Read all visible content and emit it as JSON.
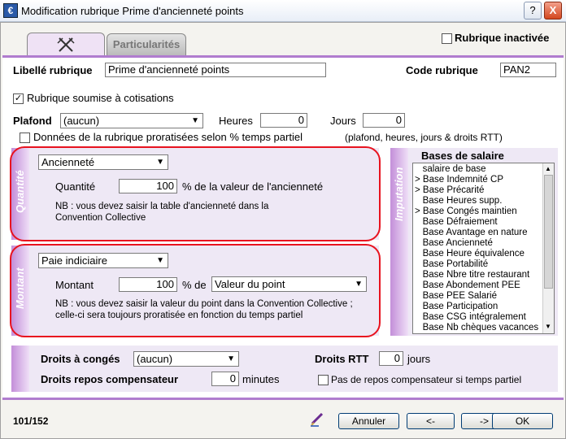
{
  "window": {
    "title": "Modification rubrique Prime d'ancienneté points",
    "app_icon": "€",
    "help_label": "?",
    "close_label": "X"
  },
  "tabs": {
    "icon_label": "✕",
    "particularites": "Particularités"
  },
  "rubrique_inactivee": {
    "label": "Rubrique inactivée",
    "checked": ""
  },
  "libelle": {
    "label": "Libellé rubrique",
    "value": "Prime d'ancienneté points"
  },
  "code": {
    "label": "Code rubrique",
    "value": "PAN2"
  },
  "cotisations": {
    "label": "Rubrique soumise à cotisations",
    "checked": "✓"
  },
  "plafond": {
    "label": "Plafond",
    "selected": "(aucun)",
    "heures_label": "Heures",
    "heures_value": "0",
    "jours_label": "Jours",
    "jours_value": "0"
  },
  "prorata": {
    "label": "Données de la rubrique proratisées selon % temps partiel",
    "note": "(plafond, heures, jours & droits RTT)",
    "checked": ""
  },
  "quantite_section": {
    "side_label": "Quantité",
    "selected": "Ancienneté",
    "field_label": "Quantité",
    "value": "100",
    "suffix": "% de la valeur de l'ancienneté",
    "note": "NB : vous devez saisir la table d'ancienneté dans la Convention Collective"
  },
  "montant_section": {
    "side_label": "Montant",
    "selected": "Paie indiciaire",
    "field_label": "Montant",
    "value": "100",
    "suffix": "% de",
    "base_selected": "Valeur du point",
    "note": "NB : vous devez saisir la valeur du point dans la Convention Collective ; celle-ci sera toujours proratisée en fonction du temps partiel"
  },
  "imputation": {
    "side_label": "Imputation",
    "title": "Bases de salaire",
    "items": [
      "   salaire de base",
      "> Base Indemnité CP",
      "> Base Précarité",
      "   Base Heures supp.",
      "> Base Congés maintien",
      "   Base Défraiement",
      "   Base Avantage en nature",
      "   Base Ancienneté",
      "   Base Heure équivalence",
      "   Base Portabilité",
      "   Base Nbre titre restaurant",
      "   Base Abondement PEE",
      "   Base PEE Salarié",
      "   Base Participation",
      "   Base CSG intégralement",
      "   Base Nb chèques vacances"
    ]
  },
  "droits": {
    "conges_label": "Droits à congés",
    "conges_selected": "(aucun)",
    "rtt_label": "Droits RTT",
    "rtt_value": "0",
    "rtt_suffix": "jours",
    "repos_label": "Droits repos compensateur",
    "repos_value": "0",
    "repos_suffix": "minutes",
    "pas_repos_label": "Pas de repos compensateur si temps partiel",
    "pas_repos_checked": ""
  },
  "footer": {
    "counter": "101/152",
    "annuler": "Annuler",
    "prev": "<-",
    "next": "->",
    "ok": "OK"
  }
}
